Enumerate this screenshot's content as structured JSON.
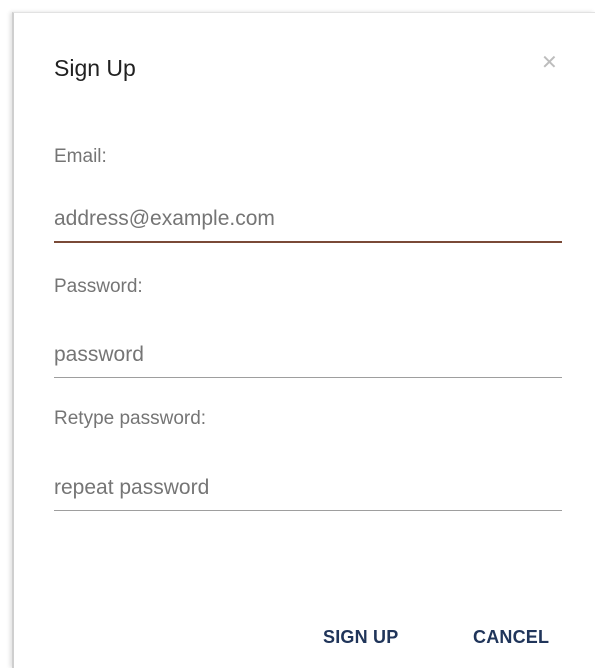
{
  "dialog": {
    "title": "Sign Up",
    "close_icon": "close-icon"
  },
  "form": {
    "email": {
      "label": "Email:",
      "placeholder": "address@example.com",
      "value": ""
    },
    "password": {
      "label": "Password:",
      "placeholder": "password",
      "value": ""
    },
    "retype_password": {
      "label": "Retype password:",
      "placeholder": "repeat password",
      "value": ""
    }
  },
  "actions": {
    "sign_up_label": "SIGN UP",
    "cancel_label": "CANCEL"
  },
  "colors": {
    "focus_underline": "#7a4a37",
    "button_text": "#20355a"
  }
}
